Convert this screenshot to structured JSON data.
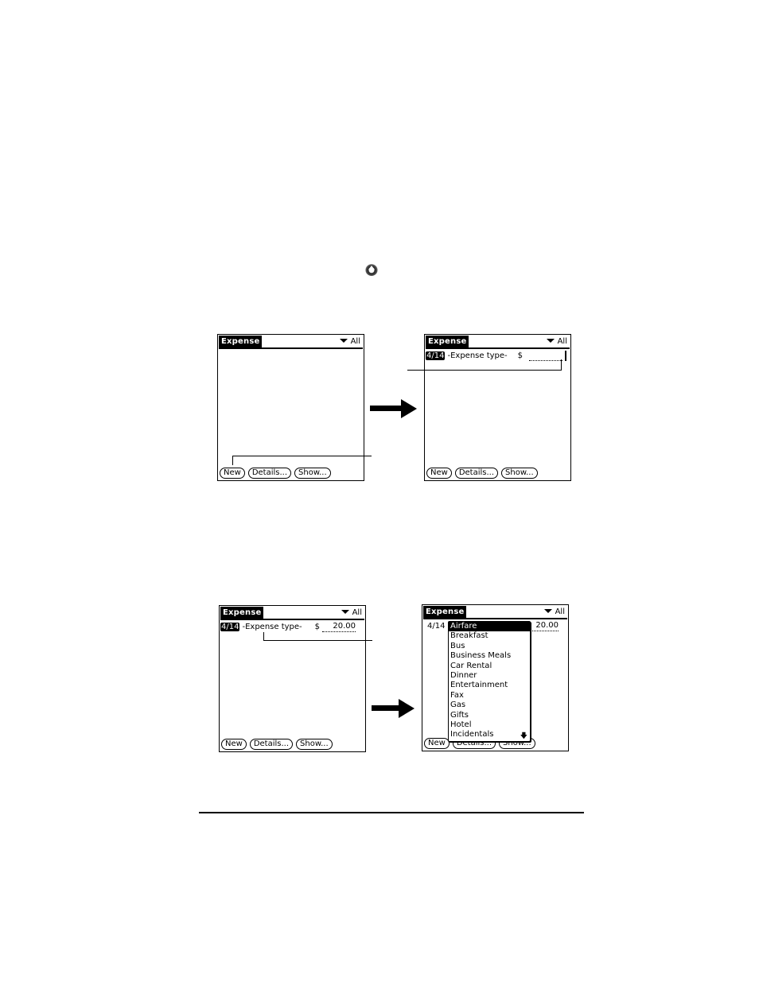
{
  "page": {
    "home_icon": "applications-home-icon"
  },
  "screens": [
    {
      "title": "Expense",
      "category": "All",
      "buttons": [
        "New",
        "Details...",
        "Show..."
      ]
    },
    {
      "title": "Expense",
      "category": "All",
      "row": {
        "date": "4/14",
        "type": "-Expense type-",
        "currency": "$",
        "amount": ""
      },
      "buttons": [
        "New",
        "Details...",
        "Show..."
      ]
    },
    {
      "title": "Expense",
      "category": "All",
      "row": {
        "date": "4/14",
        "type": "-Expense type-",
        "currency": "$",
        "amount": "20.00"
      },
      "buttons": [
        "New",
        "Details...",
        "Show..."
      ]
    },
    {
      "title": "Expense",
      "category": "All",
      "row": {
        "date": "4/14",
        "amount": "20.00"
      },
      "buttons": [
        "New",
        "Details...",
        "Show..."
      ],
      "expense_type_list": {
        "selected": "Airfare",
        "items": [
          "Airfare",
          "Breakfast",
          "Bus",
          "Business Meals",
          "Car Rental",
          "Dinner",
          "Entertainment",
          "Fax",
          "Gas",
          "Gifts",
          "Hotel",
          "Incidentals"
        ],
        "scroll_icon": "scroll-down-arrow-icon"
      }
    }
  ]
}
